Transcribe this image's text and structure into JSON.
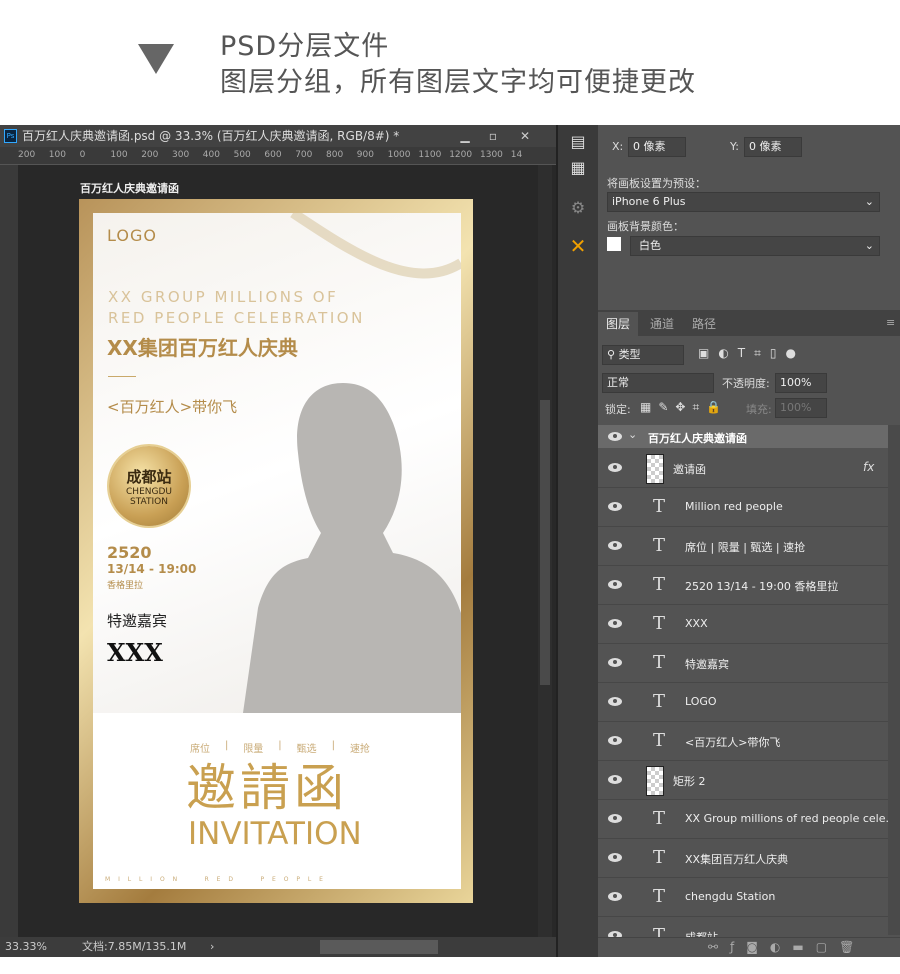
{
  "header": {
    "line1": "PSD分层文件",
    "line2": "图层分组，所有图层文字均可便捷更改"
  },
  "document": {
    "title": "百万红人庆典邀请函.psd @ 33.3% (百万红人庆典邀请函, RGB/8#) *",
    "artboard_label": "百万红人庆典邀请函",
    "ruler_ticks": [
      "200",
      "100",
      "0",
      "100",
      "200",
      "300",
      "400",
      "500",
      "600",
      "700",
      "800",
      "900",
      "1000",
      "1100",
      "1200",
      "1300",
      "14"
    ],
    "zoom": "33.33%",
    "doc_size": "文档:7.85M/135.1M"
  },
  "poster": {
    "logo": "LOGO",
    "en_title_1": "XX GROUP MILLIONS OF",
    "en_title_2": "RED PEOPLE CELEBRATION",
    "cn_title": "XX集团百万红人庆典",
    "slogan": "<百万红人>带你飞",
    "badge_cn": "成都站",
    "badge_en1": "CHENGDU",
    "badge_en2": "STATION",
    "year": "2520",
    "date": "13/14 - 19:00",
    "venue": "香格里拉",
    "guest_label": "特邀嘉宾",
    "guest_name": "XXX",
    "tags": [
      "席位",
      "限量",
      "甄选",
      "速抢"
    ],
    "invite_cn": "邀請函",
    "invite_en": "INVITATION",
    "footer": "M I L L I O N     R E D     P E O P L E",
    "accent": "#b48c4a"
  },
  "properties": {
    "x_label": "X:",
    "x_value": "0 像素",
    "y_label": "Y:",
    "y_value": "0 像素",
    "preset_label": "将画板设置为预设：",
    "preset_value": "iPhone 6 Plus",
    "bg_label": "画板背景颜色：",
    "bg_value": "白色"
  },
  "layers_panel": {
    "tabs": [
      "图层",
      "通道",
      "路径"
    ],
    "filter": "类型",
    "blend": "正常",
    "opacity_label": "不透明度:",
    "opacity": "100%",
    "lock_label": "锁定:",
    "fill_label": "填充:",
    "fill": "100%",
    "group": "百万红人庆典邀请函",
    "layers": [
      {
        "name": "邀请函",
        "type": "smart",
        "fx": "fx"
      },
      {
        "name": "Million red people",
        "type": "text"
      },
      {
        "name": "席位 | 限量 | 甄选 | 速抢",
        "type": "text"
      },
      {
        "name": "2520  13/14 - 19:00 香格里拉",
        "type": "text"
      },
      {
        "name": "XXX",
        "type": "text"
      },
      {
        "name": "特邀嘉宾",
        "type": "text"
      },
      {
        "name": "LOGO",
        "type": "text"
      },
      {
        "name": "<百万红人>带你飞",
        "type": "text"
      },
      {
        "name": "矩形 2",
        "type": "shape"
      },
      {
        "name": "XX Group millions of  red people cele...",
        "type": "text"
      },
      {
        "name": "XX集团百万红人庆典",
        "type": "text"
      },
      {
        "name": "chengdu Station",
        "type": "text"
      },
      {
        "name": "成都站",
        "type": "text"
      }
    ]
  }
}
